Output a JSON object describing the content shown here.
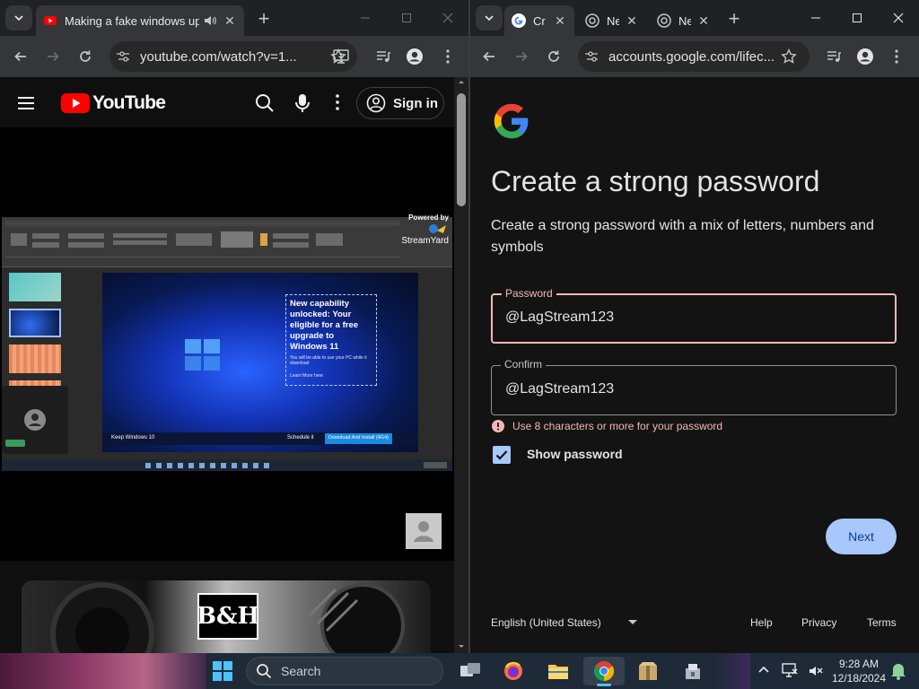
{
  "left_window": {
    "tab_title": "Making a fake windows upgrade",
    "url": "youtube.com/watch?v=1...",
    "youtube": {
      "logo_text": "YouTube",
      "sign_in_label": "Sign in"
    },
    "video": {
      "streamyard_powered": "Powered by",
      "streamyard_name": "StreamYard",
      "slide_headline": "New capability unlocked: Your eligible for a free upgrade to Windows 11",
      "slide_subtext": "You will be able to use your PC while it download",
      "slide_link": "Learn More here",
      "keep_label": "Keep Windows 10",
      "schedule_label": "Schedule it",
      "download_label": "Download And Install (4G4)"
    },
    "ad_logo": "B&H"
  },
  "right_window": {
    "tabs": [
      {
        "title": "Cr"
      },
      {
        "title": "New T"
      },
      {
        "title": "New T"
      }
    ],
    "url": "accounts.google.com/lifec...",
    "page": {
      "heading": "Create a strong password",
      "description": "Create a strong password with a mix of letters, numbers and symbols",
      "password_label": "Password",
      "password_value": "@LagStream123",
      "confirm_label": "Confirm",
      "confirm_value": "@LagStream123",
      "error_text": "Use 8 characters or more for your password",
      "show_password_label": "Show password",
      "show_password_checked": true,
      "next_label": "Next",
      "language": "English (United States)",
      "footer_links": [
        "Help",
        "Privacy",
        "Terms"
      ]
    }
  },
  "taskbar": {
    "search_placeholder": "Search",
    "time": "9:28 AM",
    "date": "12/18/2024"
  },
  "colors": {
    "accent_blue": "#a8c7fa",
    "error": "#f2b8b5",
    "youtube_red": "#ff0000",
    "taskbar": "#1f2a38"
  }
}
